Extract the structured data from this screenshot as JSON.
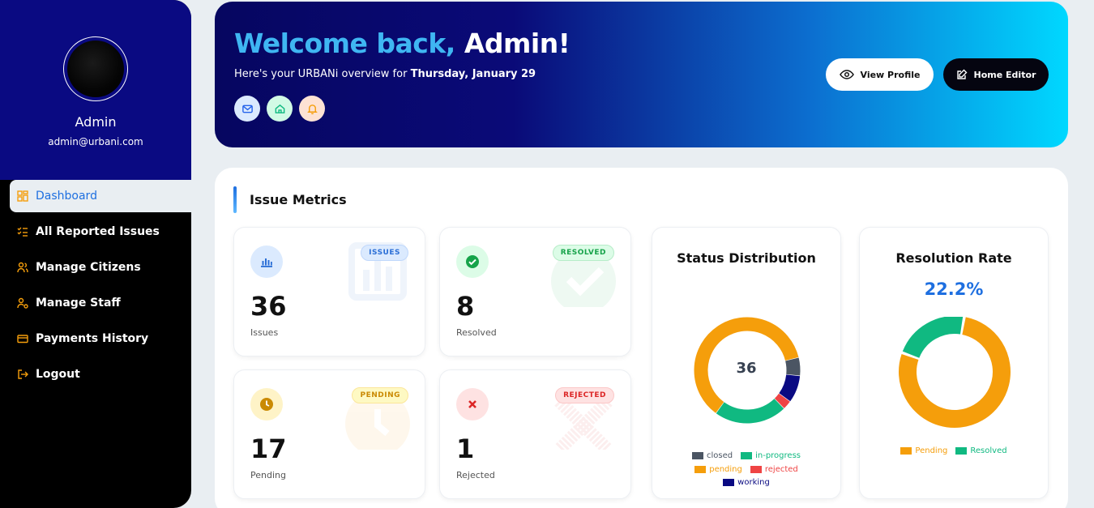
{
  "sidebar": {
    "name": "Admin",
    "email": "admin@urbani.com",
    "items": [
      {
        "label": "Dashboard",
        "icon": "dashboard-icon"
      },
      {
        "label": "All Reported Issues",
        "icon": "checklist-icon"
      },
      {
        "label": "Manage Citizens",
        "icon": "users-icon"
      },
      {
        "label": "Manage Staff",
        "icon": "staff-icon"
      },
      {
        "label": "Payments History",
        "icon": "card-icon"
      },
      {
        "label": "Logout",
        "icon": "logout-icon"
      }
    ]
  },
  "hero": {
    "greeting": "Welcome back,",
    "user": "Admin!",
    "subtitle_prefix": "Here's your URBANi overview for",
    "date": "Thursday, January 29",
    "view_profile": "View Profile",
    "home_editor": "Home Editor"
  },
  "metrics": {
    "title": "Issue Metrics",
    "cards": [
      {
        "badge": "ISSUES",
        "value": "36",
        "label": "Issues",
        "color": "#2b6fd6"
      },
      {
        "badge": "RESOLVED",
        "value": "8",
        "label": "Resolved",
        "color": "#16a34a"
      },
      {
        "badge": "PENDING",
        "value": "17",
        "label": "Pending",
        "color": "#ca8a04"
      },
      {
        "badge": "REJECTED",
        "value": "1",
        "label": "Rejected",
        "color": "#dc2626"
      }
    ]
  },
  "status_chart": {
    "title": "Status Distribution",
    "center_value": "36",
    "legend": [
      {
        "label": "closed",
        "color": "#4b5563"
      },
      {
        "label": "in-progress",
        "color": "#10b981"
      },
      {
        "label": "pending",
        "color": "#f59e0b"
      },
      {
        "label": "rejected",
        "color": "#ef4444"
      },
      {
        "label": "working",
        "color": "#0a0a82"
      }
    ]
  },
  "resolution_chart": {
    "title": "Resolution Rate",
    "rate": "22.2%",
    "legend": [
      {
        "label": "Pending",
        "color": "#f59e0b"
      },
      {
        "label": "Resolved",
        "color": "#10b981"
      }
    ]
  },
  "chart_data": [
    {
      "type": "pie",
      "title": "Status Distribution",
      "categories": [
        "closed",
        "working",
        "rejected",
        "in-progress",
        "pending"
      ],
      "values": [
        2,
        3,
        1,
        8,
        22
      ]
    },
    {
      "type": "pie",
      "title": "Resolution Rate",
      "categories": [
        "Pending",
        "Resolved"
      ],
      "values": [
        77.8,
        22.2
      ]
    }
  ]
}
